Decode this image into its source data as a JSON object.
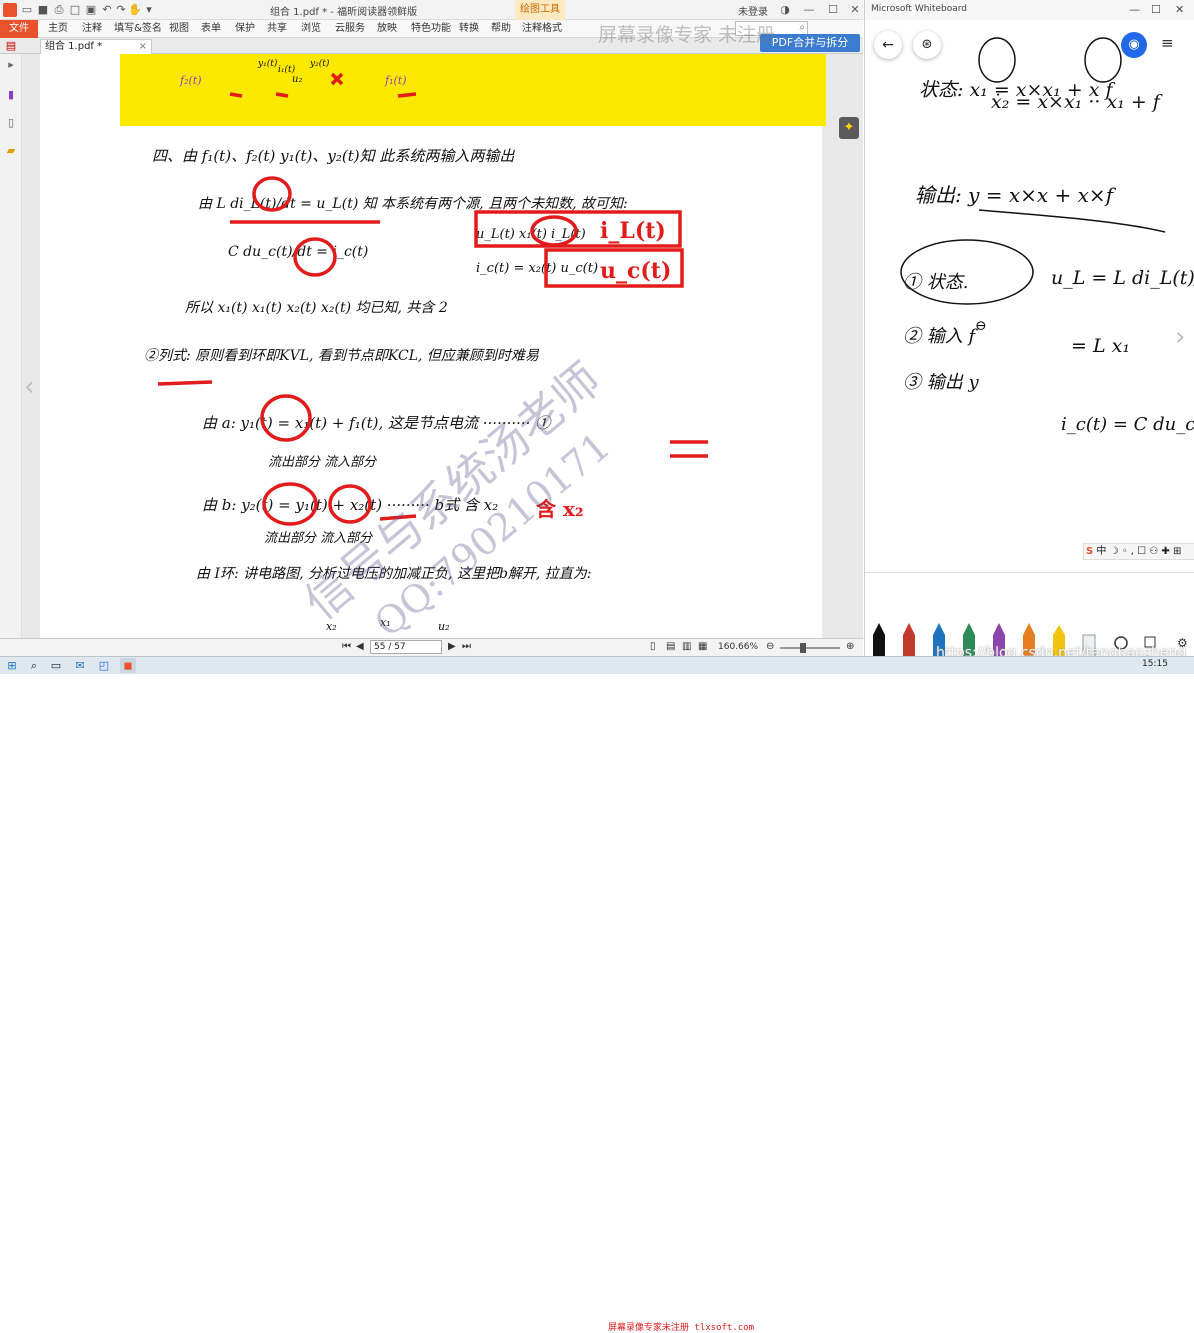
{
  "reader": {
    "window_title": "组合 1.pdf * - 福昕阅读器领鲜版",
    "context_tab": "绘图工具",
    "login": "未登录",
    "ribbon_tabs": [
      "文件",
      "主页",
      "注释",
      "填写&签名",
      "视图",
      "表单",
      "保护",
      "共享",
      "浏览",
      "云服务",
      "放映",
      "特色功能",
      "转换",
      "帮助",
      "注释格式"
    ],
    "doc_tab": "组合 1.pdf *",
    "doc_tab_close": "×",
    "merge_button": "PDF合并与拆分",
    "page_indicator": "55 / 57",
    "zoom_level": "160.66%",
    "icons": [
      "app-logo",
      "open-folder-icon",
      "save-icon",
      "print-icon",
      "undo-icon",
      "redo-icon",
      "hand-icon",
      "search-icon",
      "bookmark-icon",
      "pages-icon",
      "comment-icon",
      "lightbulb-icon"
    ]
  },
  "notes": {
    "line1": "四、由 f₁(t)、f₂(t)    y₁(t)、y₂(t)知 此系统两输入两输出",
    "line2": "由  L di_L(t)/dt = u_L(t) 知  本系统有两个源, 且两个未知数, 故可知:",
    "line3": "C du_c(t)/dt = i_c(t)",
    "line4": "u_L(t)   x₁(t)   i_L(t)",
    "line5": "i_c(t) = x₂(t)   u_c(t)",
    "line6": "所以   x₁(t)   x₁(t)   x₂(t)  x₂(t) 均已知, 共含 2",
    "line7": "②列式:  原则看到环即KVL, 看到节点即KCL, 但应兼顾到时难易",
    "line8": "由 a:  y₁(t) = x₁(t) + f₁(t),  这是节点电流  ·········· ①",
    "line9": "流出部分      流入部分",
    "line10": "由 b:  y₂(t) = y₁(t) + x₂(t)  ········· b式     含 x₂",
    "line11": "流出部分      流入部分",
    "line12": "由 I环:  讲电路图, 分析过电压的加减正负, 这里把b解开, 拉直为:",
    "bottom_labels": [
      "x₂",
      "x₁",
      "u₂"
    ],
    "band_labels": [
      "f₂(t)",
      "y₁(t)",
      "i₁(t)",
      "y₂(t)",
      "u₂",
      "f₁(t)"
    ]
  },
  "whiteboard": {
    "title": "Microsoft Whiteboard",
    "controls": [
      "—",
      "☐",
      "✕"
    ],
    "lines": [
      "状态:  x₁ = x×x₁ + x f",
      "ẋ₂ = x×x₁ ·· x₁ + f",
      "输出:  y = x×x + x×f",
      "① 状态.",
      "② 输入 f",
      "③ 输出 y",
      "u_L = L di_L(t)/dt",
      "= L x₁",
      "i_c(t) = C du_c(t)/dt"
    ],
    "ime": "中 ☽ ◦ , ☐ ⚇ ✚ ⊞"
  },
  "watermarks": {
    "recorder": "屏幕录像专家 未注册",
    "bottom": "屏幕录像专家未注册 tlxsoft.com",
    "csdn": "https://blog.csdn.net/tangbaozheng",
    "diag_1": "信号与系统汤老师",
    "diag_2": "QQ:790210171"
  },
  "taskbar": {
    "clock": "15:15",
    "icons": [
      "start-icon",
      "search-icon",
      "task-view-icon",
      "mail-icon",
      "whiteboard-icon",
      "reader-icon"
    ]
  },
  "colors": {
    "accent_orange": "#e8532c",
    "highlight_yellow": "#fde800",
    "ink_red": "#e21b1b",
    "ink_purple": "#8e44ad",
    "whiteboard_blue": "#2169e8"
  }
}
